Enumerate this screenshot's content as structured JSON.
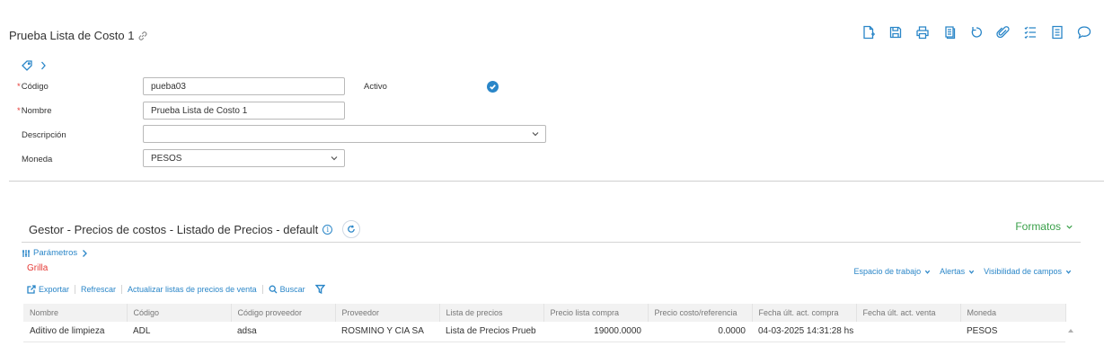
{
  "header": {
    "title": "Prueba Lista de Costo 1"
  },
  "toolbar": {
    "icons": [
      "new-document-icon",
      "save-icon",
      "print-icon",
      "copy-icon",
      "undo-icon",
      "attach-icon",
      "checklist-icon",
      "notes-icon",
      "comment-icon"
    ],
    "accent": "#2a86c8"
  },
  "form": {
    "codigo": {
      "label": "Código",
      "value": "pueba03"
    },
    "activo": {
      "label": "Activo"
    },
    "nombre": {
      "label": "Nombre",
      "value": "Prueba Lista de Costo 1"
    },
    "descripcion": {
      "label": "Descripción",
      "value": ""
    },
    "moneda": {
      "label": "Moneda",
      "value": "PESOS"
    }
  },
  "gestor": {
    "title": "Gestor - Precios de costos - Listado de Precios - default",
    "formatos_label": "Formatos",
    "parametros_label": "Parámetros",
    "grilla_label": "Grilla",
    "right_links": {
      "espacio": "Espacio de trabajo",
      "alertas": "Alertas",
      "visibilidad": "Visibilidad de campos"
    },
    "actions": {
      "exportar": "Exportar",
      "refrescar": "Refrescar",
      "actualizar": "Actualizar listas de precios de venta",
      "buscar": "Buscar"
    },
    "columns": [
      "Nombre",
      "Código",
      "Código proveedor",
      "Proveedor",
      "Lista de precios",
      "Precio lista compra",
      "Precio costo/referencia",
      "Fecha últ. act. compra",
      "Fecha últ. act. venta",
      "Moneda"
    ],
    "rows": [
      [
        "Aditivo de limpieza",
        "ADL",
        "adsa",
        "ROSMINO Y CIA SA",
        "Lista de Precios Prueb",
        "19000.0000",
        "0.0000",
        "04-03-2025 14:31:28 hs",
        "",
        "PESOS"
      ]
    ],
    "formatos_color": "#3aa04a",
    "grilla_color": "#e53935"
  }
}
